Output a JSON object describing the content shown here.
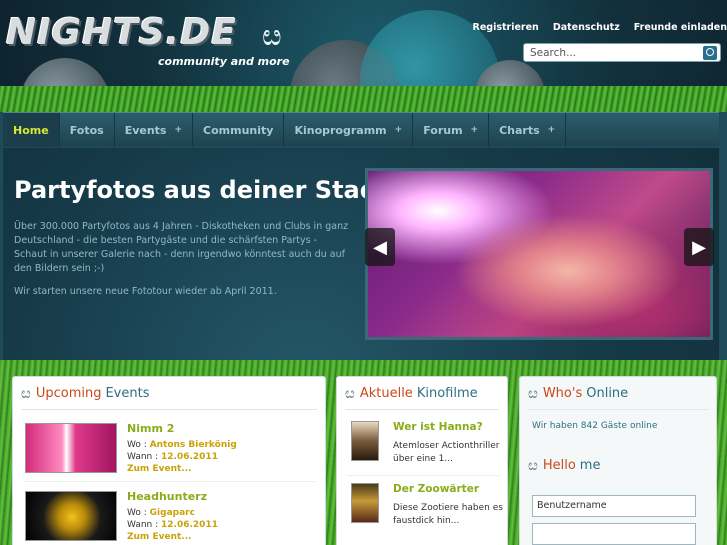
{
  "header": {
    "logo_text": "NIGHTS.DE",
    "tagline": "community and more",
    "links": [
      "Registrieren",
      "Datenschutz",
      "Freunde einladen"
    ],
    "search_placeholder": "Search..."
  },
  "nav": {
    "items": [
      {
        "label": "Home",
        "active": true,
        "has_sub": false
      },
      {
        "label": "Fotos",
        "active": false,
        "has_sub": false
      },
      {
        "label": "Events",
        "active": false,
        "has_sub": true
      },
      {
        "label": "Community",
        "active": false,
        "has_sub": false
      },
      {
        "label": "Kinoprogramm",
        "active": false,
        "has_sub": true
      },
      {
        "label": "Forum",
        "active": false,
        "has_sub": true
      },
      {
        "label": "Charts",
        "active": false,
        "has_sub": true
      }
    ],
    "sub_glyph": "+"
  },
  "hero": {
    "title": "Partyfotos aus deiner Stadt",
    "text": "Über 300.000 Partyfotos aus 4 Jahren - Diskotheken und Clubs in ganz Deutschland - die besten Partygäste und die schärfsten Partys - Schaut in unserer Galerie nach - denn irgendwo könntest auch du auf den Bildern sein ;-)",
    "text2": "Wir starten unsere neue Fototour wieder ab April 2011.",
    "prev_arrow": "◀",
    "next_arrow": "▶"
  },
  "events_panel": {
    "title_a": "Upcoming",
    "title_b": "Events",
    "where_label": "Wo :",
    "when_label": "Wann :",
    "more_label": "Zum Event...",
    "events": [
      {
        "name": "Nimm 2",
        "where": "Antons Bierkönig",
        "when": "12.06.2011"
      },
      {
        "name": "Headhunterz",
        "where": "Gigaparc",
        "when": "12.06.2011"
      }
    ]
  },
  "films_panel": {
    "title_a": "Aktuelle",
    "title_b": "Kinofilme",
    "films": [
      {
        "name": "Wer ist Hanna?",
        "desc": "Atemloser Actionthriller über eine 1..."
      },
      {
        "name": "Der Zoowärter",
        "desc": "Diese Zootiere haben es faustdick hin..."
      }
    ]
  },
  "online_panel": {
    "title_a": "Who's",
    "title_b": "Online",
    "text": "Wir haben 842 Gäste online",
    "hello_a": "Hello",
    "hello_b": "me",
    "username_placeholder": "Benutzername"
  },
  "colors": {
    "accent_green": "#d6e832",
    "title_orange": "#c94a19",
    "title_teal": "#2e6e84",
    "link_gold": "#c9a20a"
  }
}
